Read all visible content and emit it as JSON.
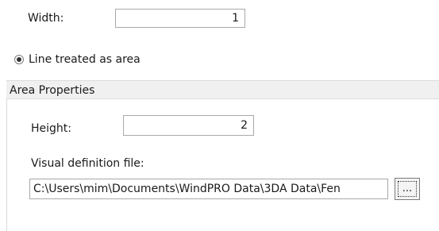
{
  "width": {
    "label": "Width:",
    "value": "1"
  },
  "mode": {
    "option_label": "Line treated as area",
    "selected": true
  },
  "area_properties": {
    "title": "Area Properties",
    "height_label": "Height:",
    "height_value": "2",
    "visual_file_label": "Visual definition file:",
    "visual_file_path": "C:\\Users\\mim\\Documents\\WindPRO Data\\3DA Data\\Fen",
    "browse_label": "..."
  }
}
